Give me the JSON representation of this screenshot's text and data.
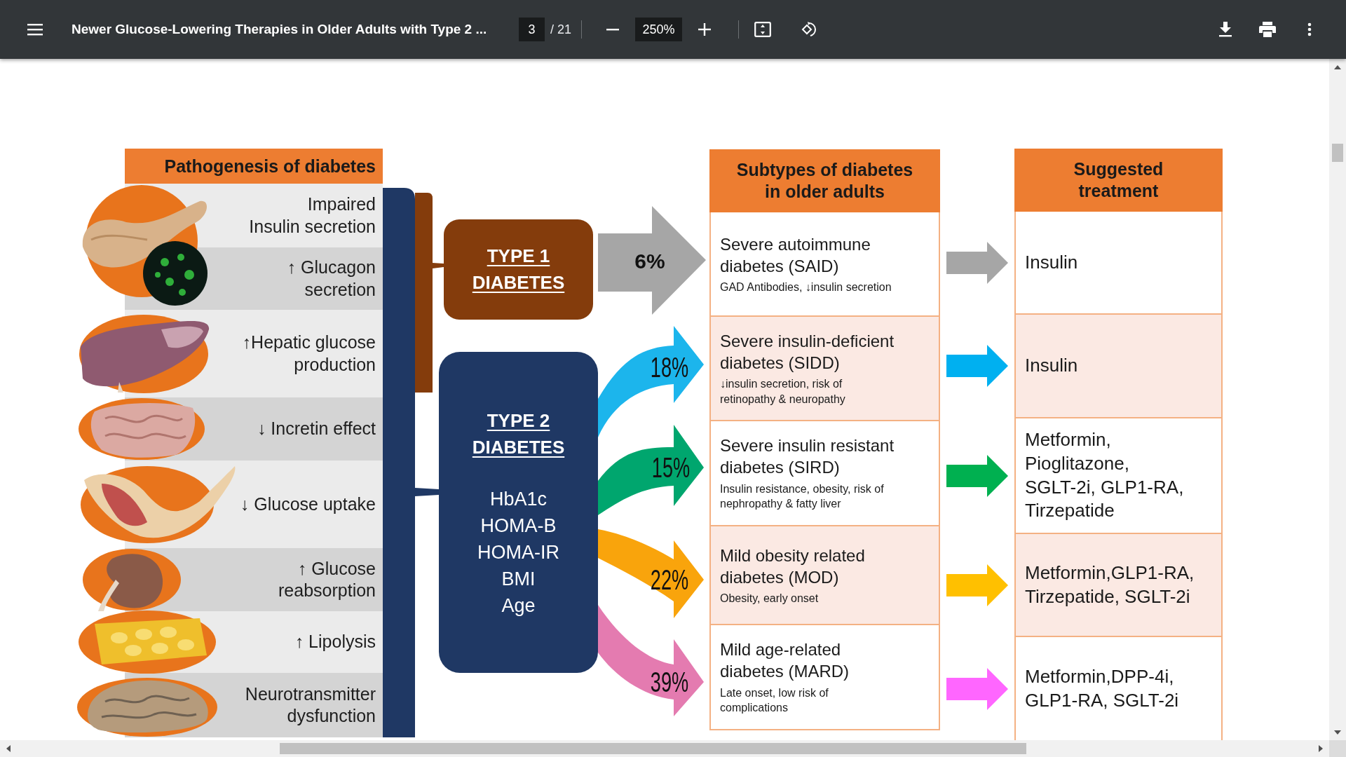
{
  "toolbar": {
    "title": "Newer Glucose-Lowering Therapies in Older Adults with Type 2 ...",
    "page": "3",
    "page_count": "/ 21",
    "zoom": "250%"
  },
  "figure": {
    "pathogenesis": {
      "header": "Pathogenesis of diabetes",
      "items": [
        "Impaired\nInsulin secretion",
        "↑ Glucagon\nsecretion",
        "↑Hepatic glucose\nproduction",
        "↓ Incretin effect",
        "↓ Glucose uptake",
        "↑ Glucose\nreabsorption",
        "↑ Lipolysis",
        "Neurotransmitter\ndysfunction"
      ]
    },
    "type_1": {
      "title": "TYPE 1\nDIABETES"
    },
    "type_2": {
      "title": "TYPE 2\nDIABETES",
      "measures": [
        "HbA1c",
        "HOMA-B",
        "HOMA-IR",
        "BMI",
        "Age"
      ]
    },
    "subtypes": {
      "header": "Subtypes of diabetes\nin older adults",
      "rows": [
        {
          "kind": "straight",
          "share": "6%",
          "color": "#a6a6a6",
          "name": "Severe autoimmune\ndiabetes (SAID)",
          "note": "GAD Antibodies, ↓insulin secretion"
        },
        {
          "kind": "curved",
          "share": "18%",
          "color": "#1cb5ec",
          "name": "Severe insulin-deficient\ndiabetes (SIDD)",
          "note": "↓insulin secretion, risk of\nretinopathy & neuropathy"
        },
        {
          "kind": "curved",
          "share": "15%",
          "color": "#00a66e",
          "name": "Severe insulin resistant\ndiabetes (SIRD)",
          "note": "Insulin resistance, obesity, risk of\nnephropathy  & fatty liver"
        },
        {
          "kind": "curved",
          "share": "22%",
          "color": "#f9a40c",
          "name": "Mild obesity related\ndiabetes (MOD)",
          "note": "Obesity, early onset"
        },
        {
          "kind": "curved",
          "share": "39%",
          "color": "#e47bb0",
          "name": "Mild age-related\ndiabetes (MARD)",
          "note": "Late onset, low risk of\ncomplications"
        }
      ]
    },
    "treatment": {
      "header": "Suggested\ntreatment",
      "rows": [
        {
          "color": "#a6a6a6",
          "text": "Insulin"
        },
        {
          "color": "#00b0f0",
          "text": "Insulin"
        },
        {
          "color": "#00b050",
          "text": "Metformin,\nPioglitazone,\nSGLT-2i, GLP1-RA,\nTirzepatide"
        },
        {
          "color": "#ffc000",
          "text": "Metformin,GLP1-RA,\nTirzepatide, SGLT-2i"
        },
        {
          "color": "#ff66ff",
          "text": "Metformin,DPP-4i,\nGLP1-RA,  SGLT-2i"
        }
      ]
    }
  }
}
